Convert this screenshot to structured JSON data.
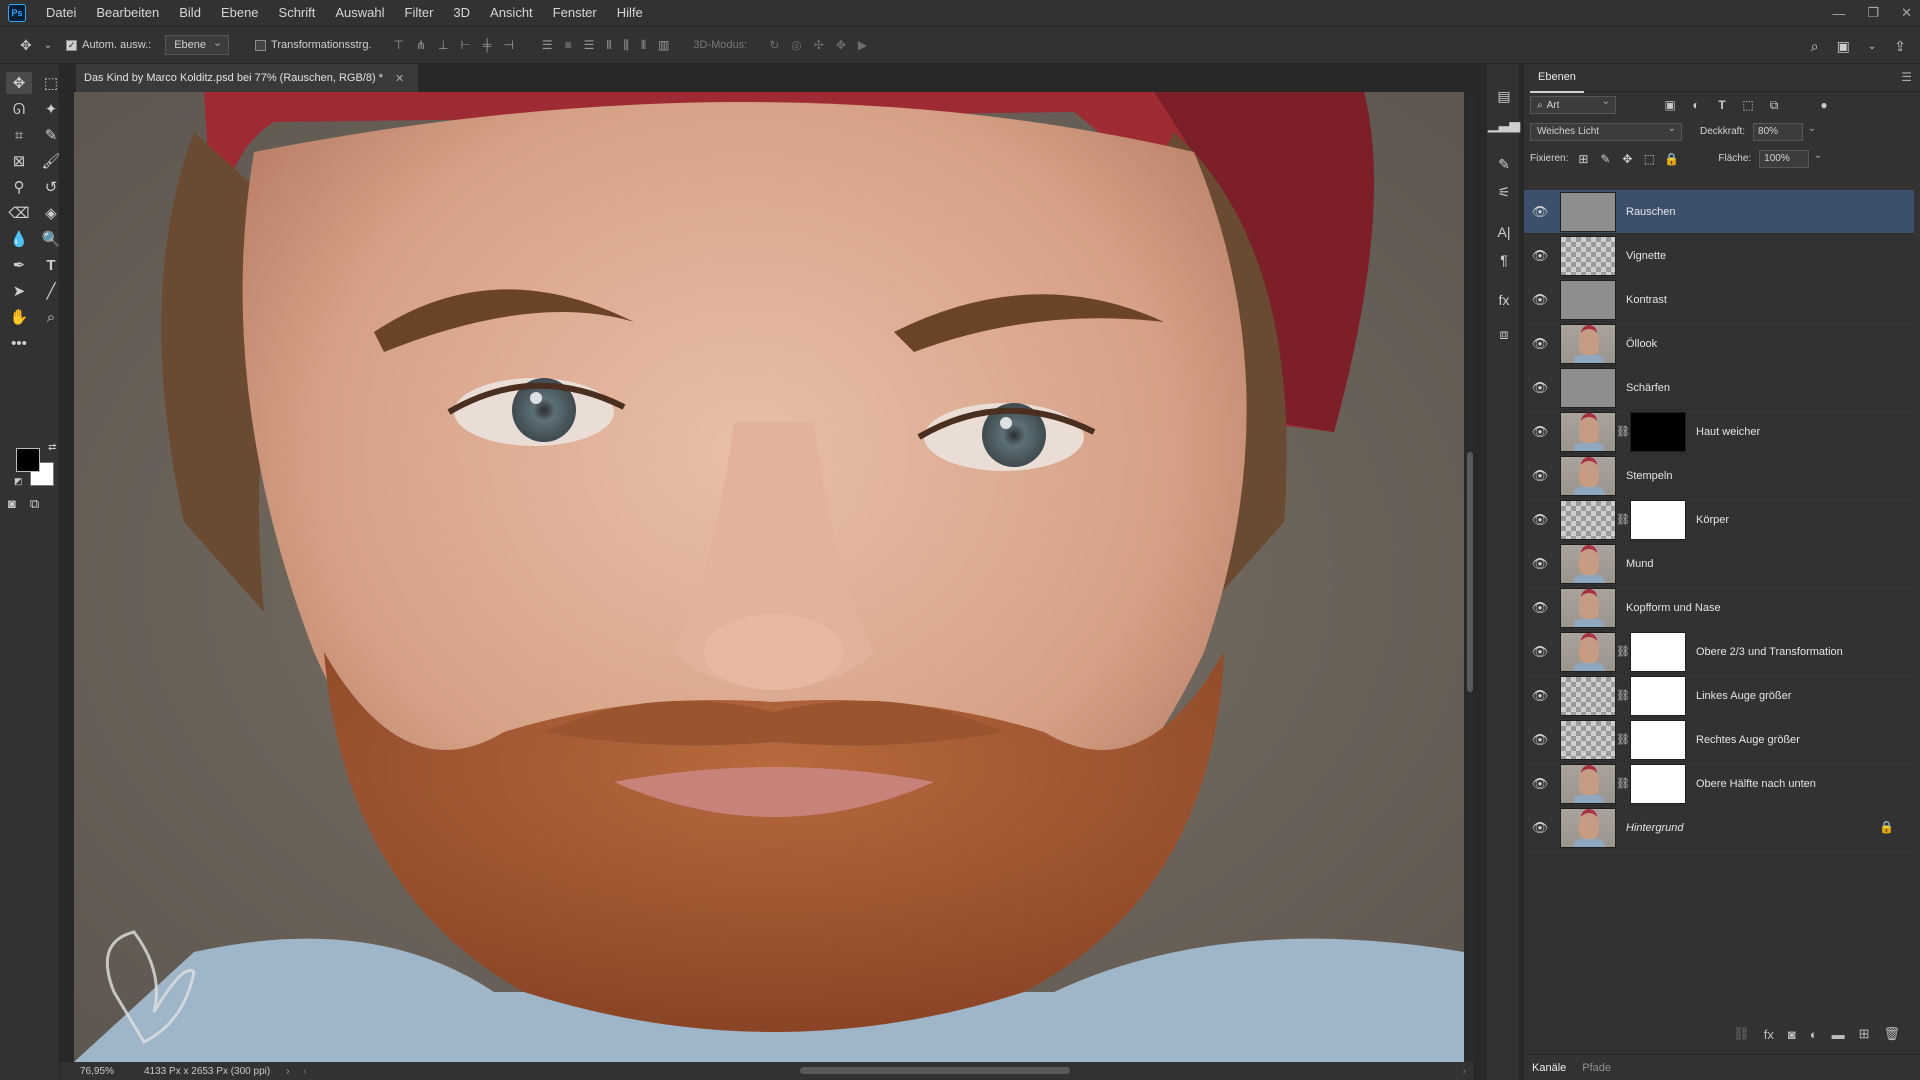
{
  "app": {
    "logo": "Ps",
    "menu": [
      "Datei",
      "Bearbeiten",
      "Bild",
      "Ebene",
      "Schrift",
      "Auswahl",
      "Filter",
      "3D",
      "Ansicht",
      "Fenster",
      "Hilfe"
    ]
  },
  "options": {
    "auto_select_label": "Autom. ausw.:",
    "auto_select_checked": true,
    "auto_select_target": "Ebene",
    "transform_controls_label": "Transformationsstrg.",
    "mode_3d_label": "3D-Modus:"
  },
  "document": {
    "tab_title": "Das Kind by Marco Kolditz.psd bei 77% (Rauschen, RGB/8) *",
    "zoom": "76,95%",
    "dimensions": "4133 Px x 2653 Px (300 ppi)"
  },
  "layers_panel": {
    "tab_label": "Ebenen",
    "filter_kind": "Art",
    "blend_mode": "Weiches Licht",
    "opacity_label": "Deckkraft:",
    "opacity_value": "80%",
    "lock_label": "Fixieren:",
    "fill_label": "Fläche:",
    "fill_value": "100%",
    "layers": [
      {
        "name": "Rauschen",
        "thumb": "gray",
        "mask": null,
        "selected": true
      },
      {
        "name": "Vignette",
        "thumb": "transparent",
        "mask": null,
        "selected": false
      },
      {
        "name": "Kontrast",
        "thumb": "gray",
        "mask": null,
        "selected": false
      },
      {
        "name": "Öllook",
        "thumb": "photo",
        "mask": null,
        "selected": false
      },
      {
        "name": "Schärfen",
        "thumb": "gray",
        "mask": null,
        "selected": false
      },
      {
        "name": "Haut weicher",
        "thumb": "photo",
        "mask": "black",
        "selected": false
      },
      {
        "name": "Stempeln",
        "thumb": "photo",
        "mask": null,
        "selected": false
      },
      {
        "name": "Körper",
        "thumb": "transparent",
        "mask": "white",
        "selected": false
      },
      {
        "name": "Mund",
        "thumb": "photo",
        "mask": null,
        "selected": false
      },
      {
        "name": "Kopfform und Nase",
        "thumb": "photo",
        "mask": null,
        "selected": false
      },
      {
        "name": "Obere 2/3 und Transformation",
        "thumb": "photo",
        "mask": "white",
        "selected": false
      },
      {
        "name": "Linkes Auge größer",
        "thumb": "transparent",
        "mask": "white",
        "selected": false
      },
      {
        "name": "Rechtes Auge größer",
        "thumb": "transparent",
        "mask": "white",
        "selected": false
      },
      {
        "name": "Obere Hälfte nach unten",
        "thumb": "photo",
        "mask": "white",
        "selected": false
      },
      {
        "name": "Hintergrund",
        "thumb": "photo",
        "mask": null,
        "selected": false,
        "locked": true,
        "italic": true
      }
    ],
    "bottom_tabs": [
      "Kanäle",
      "Pfade"
    ]
  },
  "colors": {
    "foreground": "#000000",
    "background": "#ffffff",
    "selection": "#3c506e"
  }
}
